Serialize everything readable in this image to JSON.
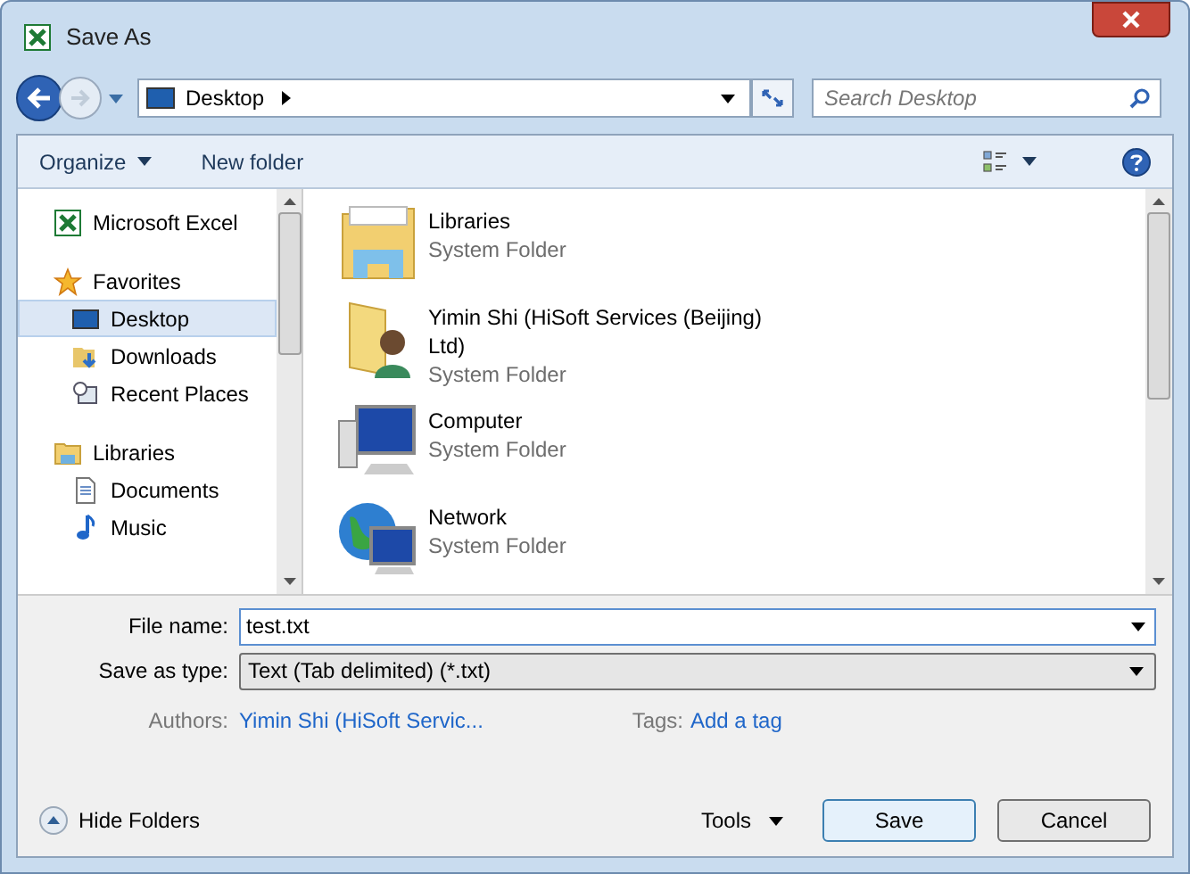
{
  "window": {
    "title": "Save As"
  },
  "address_bar": {
    "location": "Desktop"
  },
  "search": {
    "placeholder": "Search Desktop"
  },
  "toolbar": {
    "organize": "Organize",
    "new_folder": "New folder"
  },
  "sidebar": {
    "items": [
      {
        "label": "Microsoft Excel",
        "kind": "excel",
        "selected": false
      },
      {
        "label": "Favorites",
        "kind": "star",
        "selected": false,
        "children": [
          {
            "label": "Desktop",
            "kind": "desktop",
            "selected": true
          },
          {
            "label": "Downloads",
            "kind": "download",
            "selected": false
          },
          {
            "label": "Recent Places",
            "kind": "recent",
            "selected": false
          }
        ]
      },
      {
        "label": "Libraries",
        "kind": "library",
        "selected": false,
        "children": [
          {
            "label": "Documents",
            "kind": "document",
            "selected": false
          },
          {
            "label": "Music",
            "kind": "music",
            "selected": false
          }
        ]
      }
    ]
  },
  "files": [
    {
      "name": "Libraries",
      "type": "System Folder",
      "kind": "library"
    },
    {
      "name": "Yimin Shi (HiSoft Services (Beijing) Ltd)",
      "type": "System Folder",
      "kind": "user"
    },
    {
      "name": "Computer",
      "type": "System Folder",
      "kind": "computer"
    },
    {
      "name": "Network",
      "type": "System Folder",
      "kind": "network"
    }
  ],
  "form": {
    "file_name_label": "File name:",
    "file_name": "test.txt",
    "type_label": "Save as type:",
    "type": "Text (Tab delimited) (*.txt)",
    "authors_label": "Authors:",
    "authors": "Yimin Shi (HiSoft Servic...",
    "tags_label": "Tags:",
    "tags": "Add a tag"
  },
  "footer": {
    "hide_folders": "Hide Folders",
    "tools": "Tools",
    "save": "Save",
    "cancel": "Cancel"
  }
}
